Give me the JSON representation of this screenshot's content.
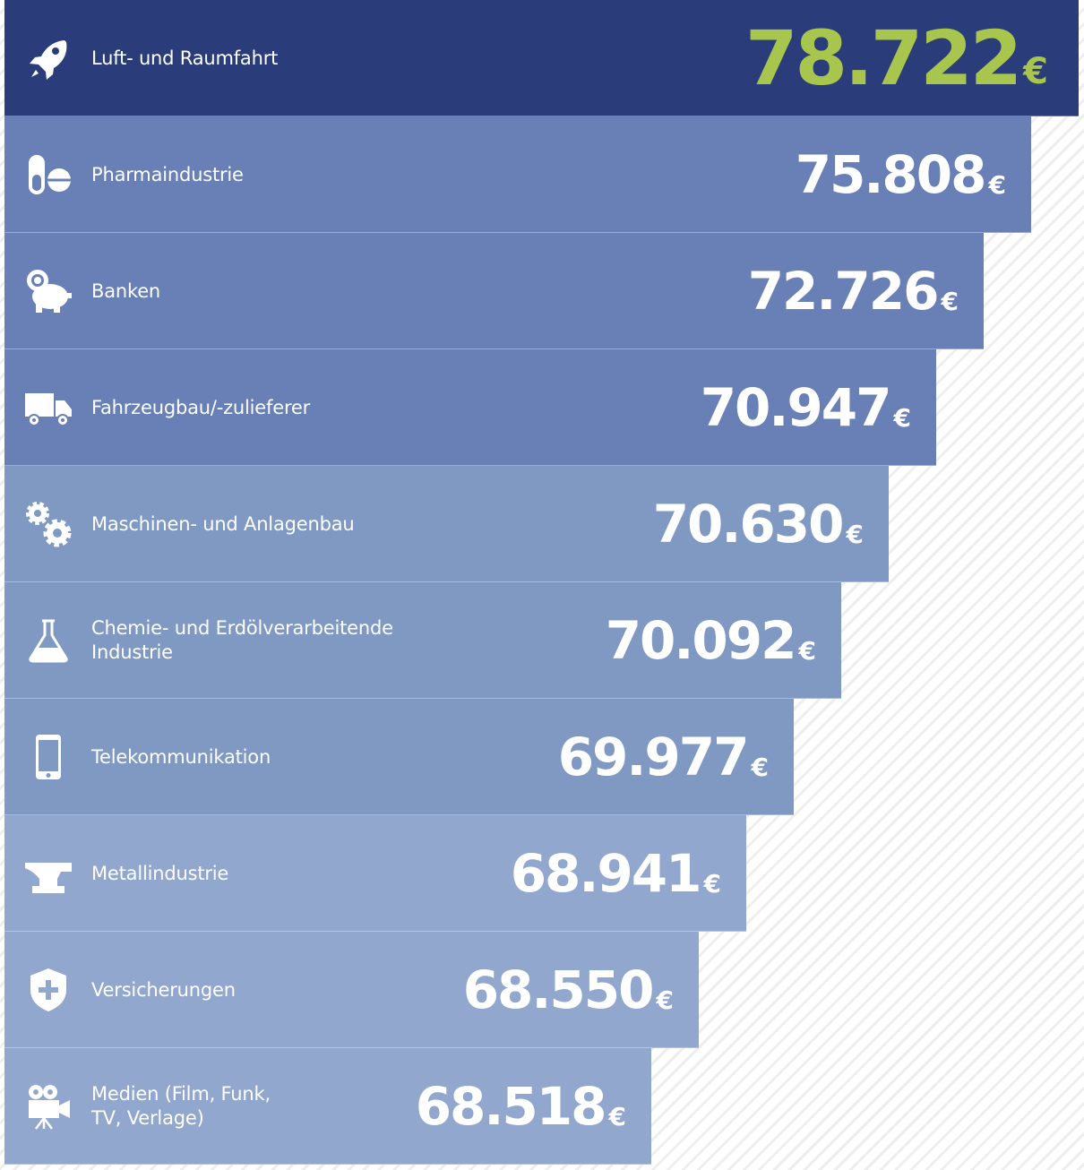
{
  "chart_data": {
    "type": "bar",
    "orientation": "horizontal",
    "currency": "€",
    "categories": [
      "Luft- und Raumfahrt",
      "Pharmaindustrie",
      "Banken",
      "Fahrzeugbau/-zulieferer",
      "Maschinen- und Anlagenbau",
      "Chemie- und Erdölverarbeitende Industrie",
      "Telekommunikation",
      "Metallindustrie",
      "Versicherungen",
      "Medien (Film, Funk,\nTV, Verlage)"
    ],
    "value_labels": [
      "78.722",
      "75.808",
      "72.726",
      "70.947",
      "70.630",
      "70.092",
      "69.977",
      "68.941",
      "68.550",
      "68.518"
    ],
    "values": [
      78722,
      75808,
      72726,
      70947,
      70630,
      70092,
      69977,
      68941,
      68550,
      68518
    ],
    "icons": [
      "rocket-icon",
      "pill-icon",
      "piggy-bank-icon",
      "truck-icon",
      "gears-icon",
      "flask-icon",
      "smartphone-icon",
      "anvil-icon",
      "shield-plus-icon",
      "movie-camera-icon"
    ],
    "grid": false,
    "legend": "none"
  },
  "colors": {
    "top_bar": "#2a3d7a",
    "top_value": "#a8c64e",
    "bar_fills": [
      "#2a3d7a",
      "#6880b6",
      "#6880b6",
      "#6880b6",
      "#7f99c3",
      "#7f99c3",
      "#7f99c3",
      "#92a7cd",
      "#92a7cd",
      "#92a7cd"
    ],
    "text": "#ffffff"
  }
}
